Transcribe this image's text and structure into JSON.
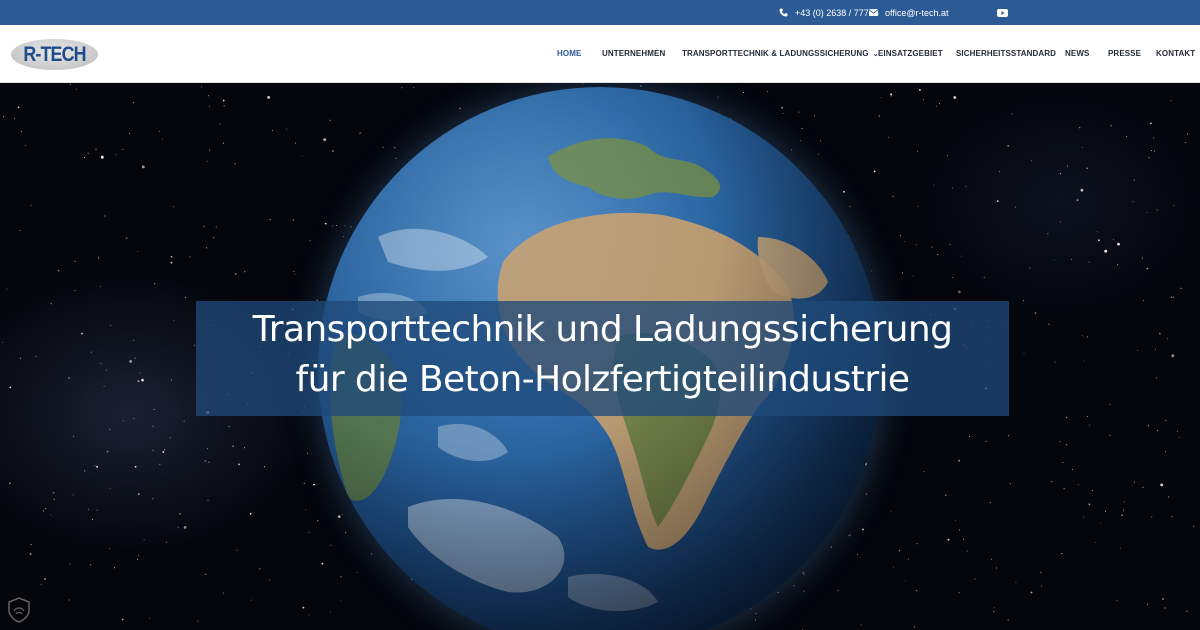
{
  "topbar": {
    "phone": "+43 (0) 2638 / 77735",
    "email": "office@r-tech.at",
    "phone_icon": "phone-icon",
    "email_icon": "envelope-icon",
    "youtube_icon": "youtube-icon"
  },
  "logo": {
    "text": "R-TECH"
  },
  "nav": {
    "items": [
      {
        "label": "HOME",
        "active": true
      },
      {
        "label": "UNTERNEHMEN"
      },
      {
        "label": "TRANSPORTTECHNIK & LADUNGSSICHERUNG",
        "has_dropdown": true
      },
      {
        "label": "EINSATZGEBIET"
      },
      {
        "label": "SICHERHEITSSTANDARD"
      },
      {
        "label": "NEWS"
      },
      {
        "label": "PRESSE"
      },
      {
        "label": "KONTAKT"
      }
    ]
  },
  "hero": {
    "line1": "Transporttechnik und Ladungssicherung",
    "line2": "für die Beton-Holzfertigteilindustrie"
  },
  "colors": {
    "topbar": "#2b5a95",
    "nav_active": "#2b5a95",
    "nav_text": "#1f2a36",
    "banner": "#1f4978"
  }
}
